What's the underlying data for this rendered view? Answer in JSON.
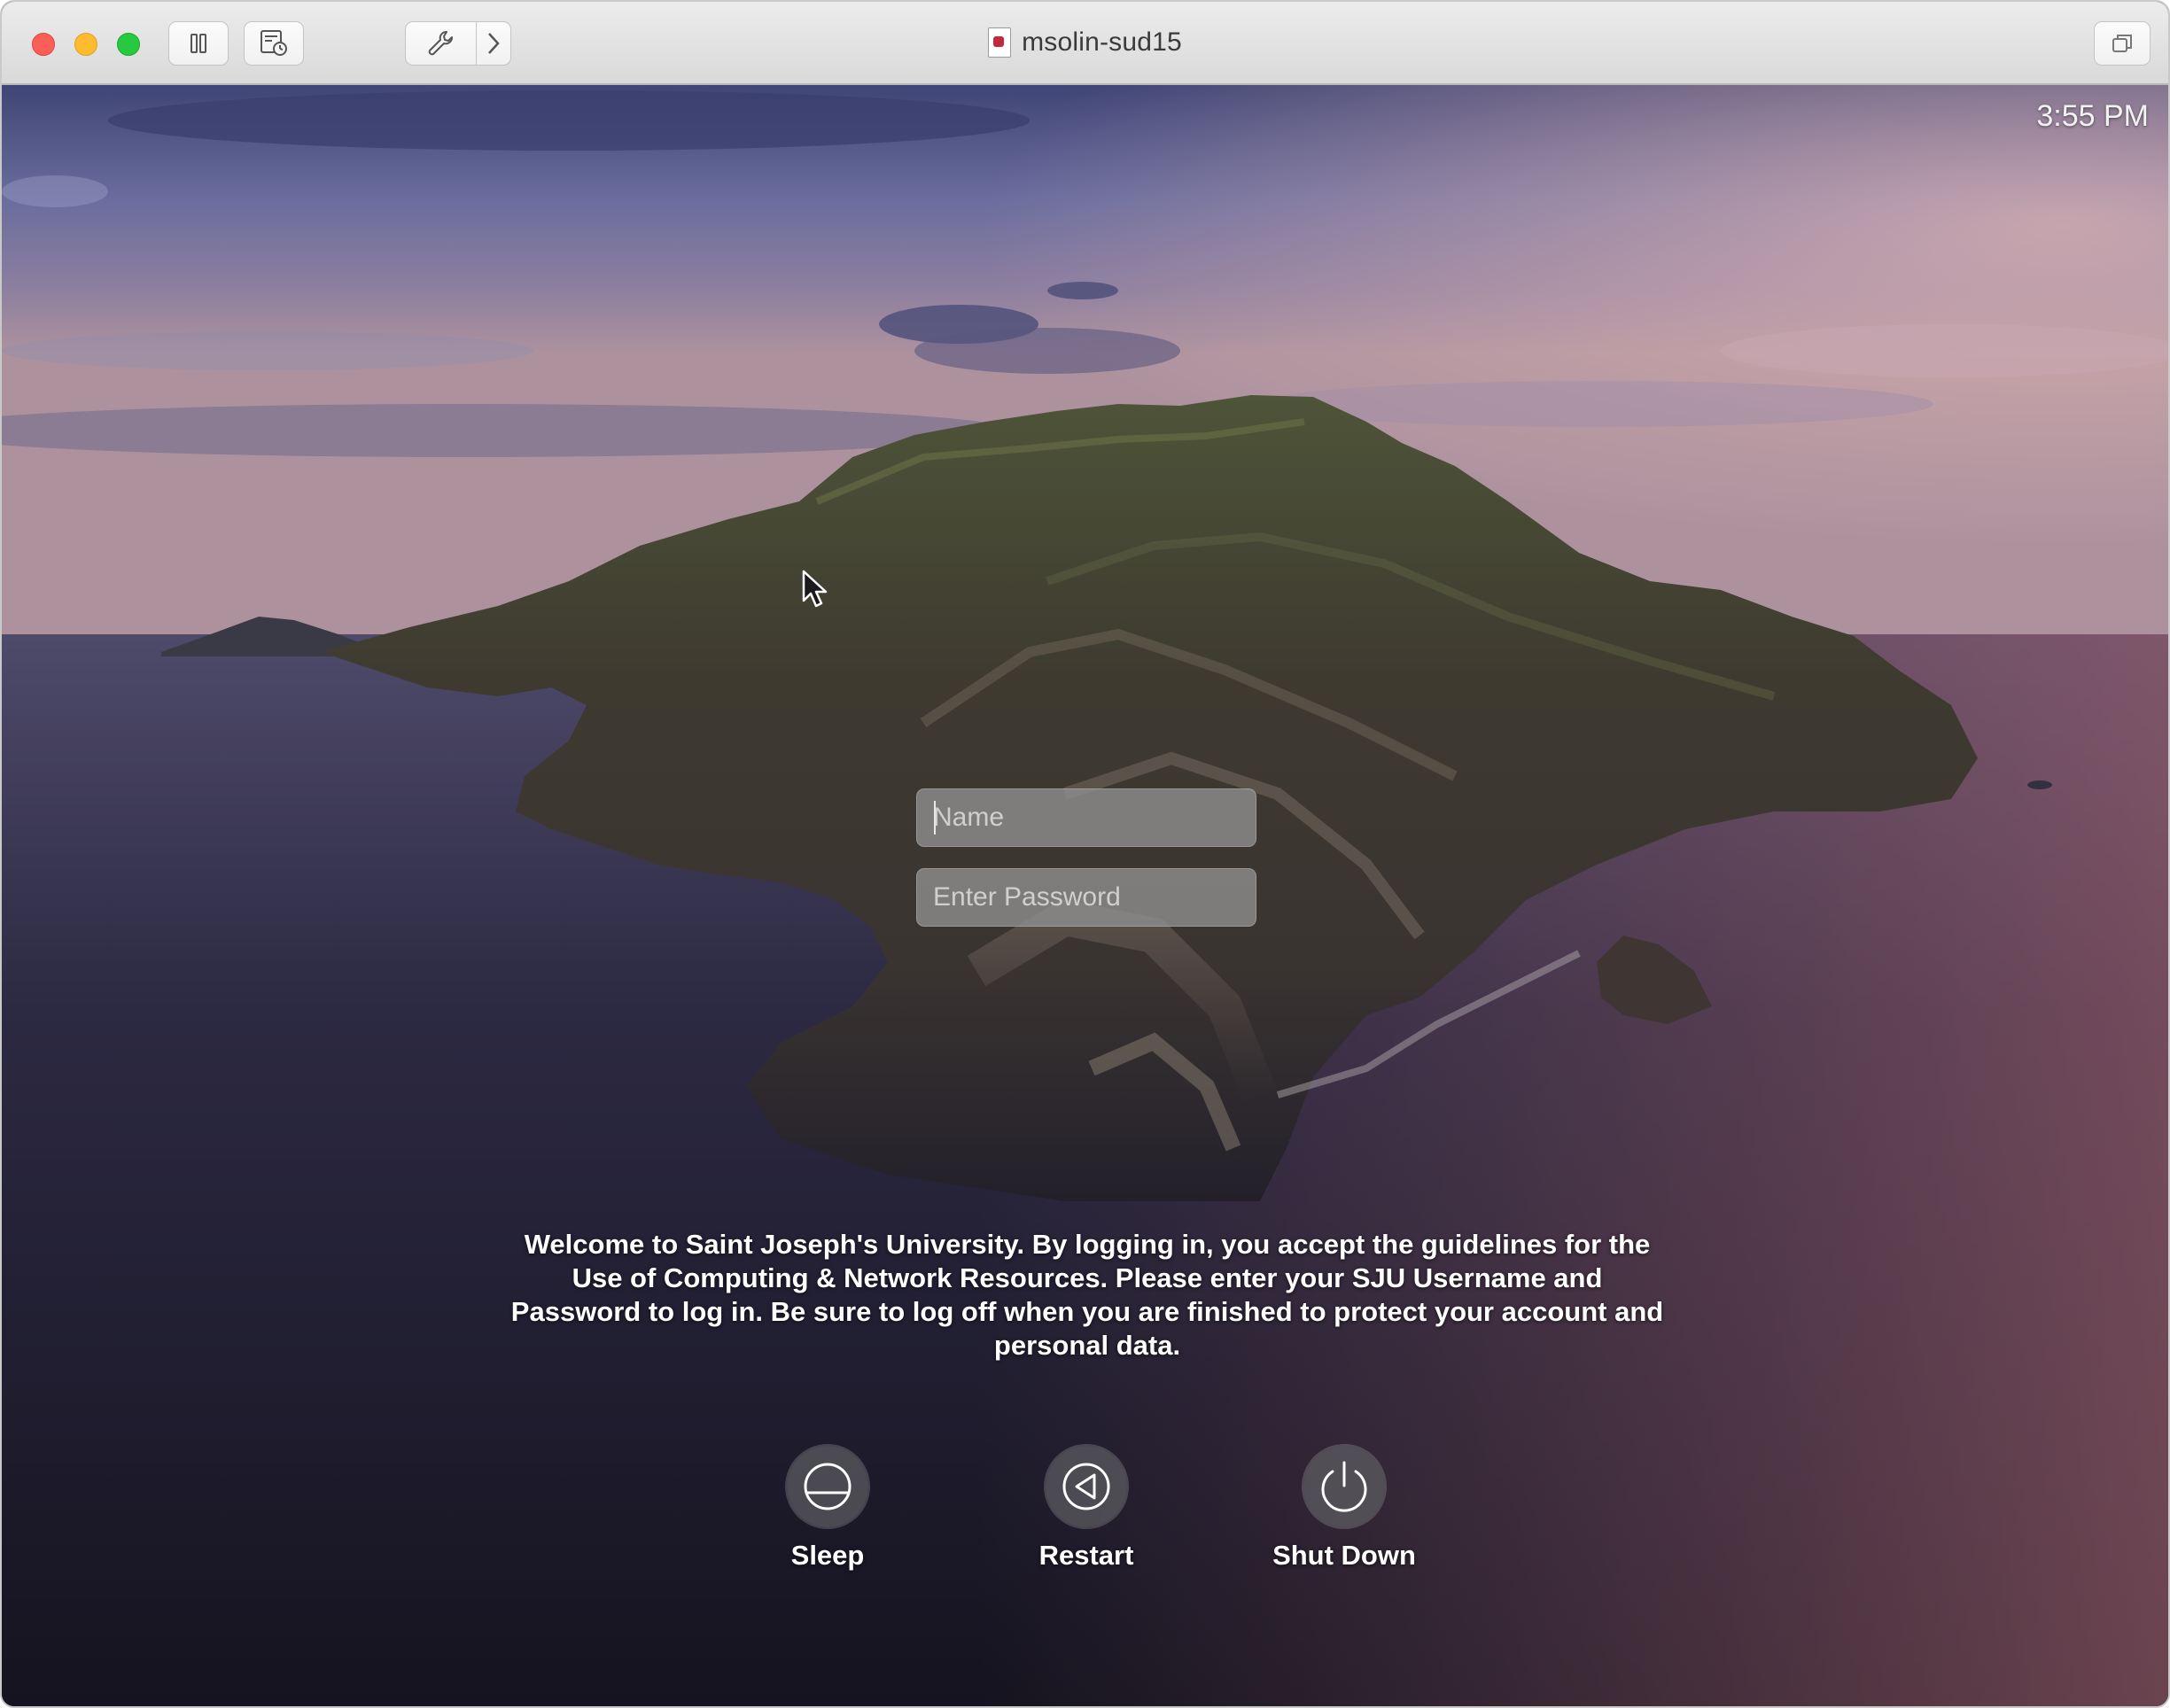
{
  "window": {
    "title": "msolin-sud15"
  },
  "toolbar": {
    "icons": [
      "pause-icon",
      "snapshot-icon",
      "wrench-icon",
      "chevron-right-icon",
      "restore-window-icon"
    ]
  },
  "login": {
    "clock": "3:55 PM",
    "name_placeholder": "Name",
    "password_placeholder": "Enter Password",
    "welcome_message": "Welcome to Saint Joseph's University. By logging in, you accept the guidelines for the Use of Computing & Network Resources. Please enter your SJU Username and Password to log in. Be sure to log off when you are finished to protect your account and personal data.",
    "buttons": [
      {
        "label": "Sleep",
        "icon": "sleep-icon"
      },
      {
        "label": "Restart",
        "icon": "restart-icon"
      },
      {
        "label": "Shut Down",
        "icon": "power-icon"
      }
    ]
  },
  "colors": {
    "close": "#fc5f57",
    "minimize": "#fdbc2e",
    "zoom": "#28c840",
    "sky_top": "#5b5f93",
    "sky_horizon": "#b7949a",
    "sea": "#1c1a2e"
  }
}
